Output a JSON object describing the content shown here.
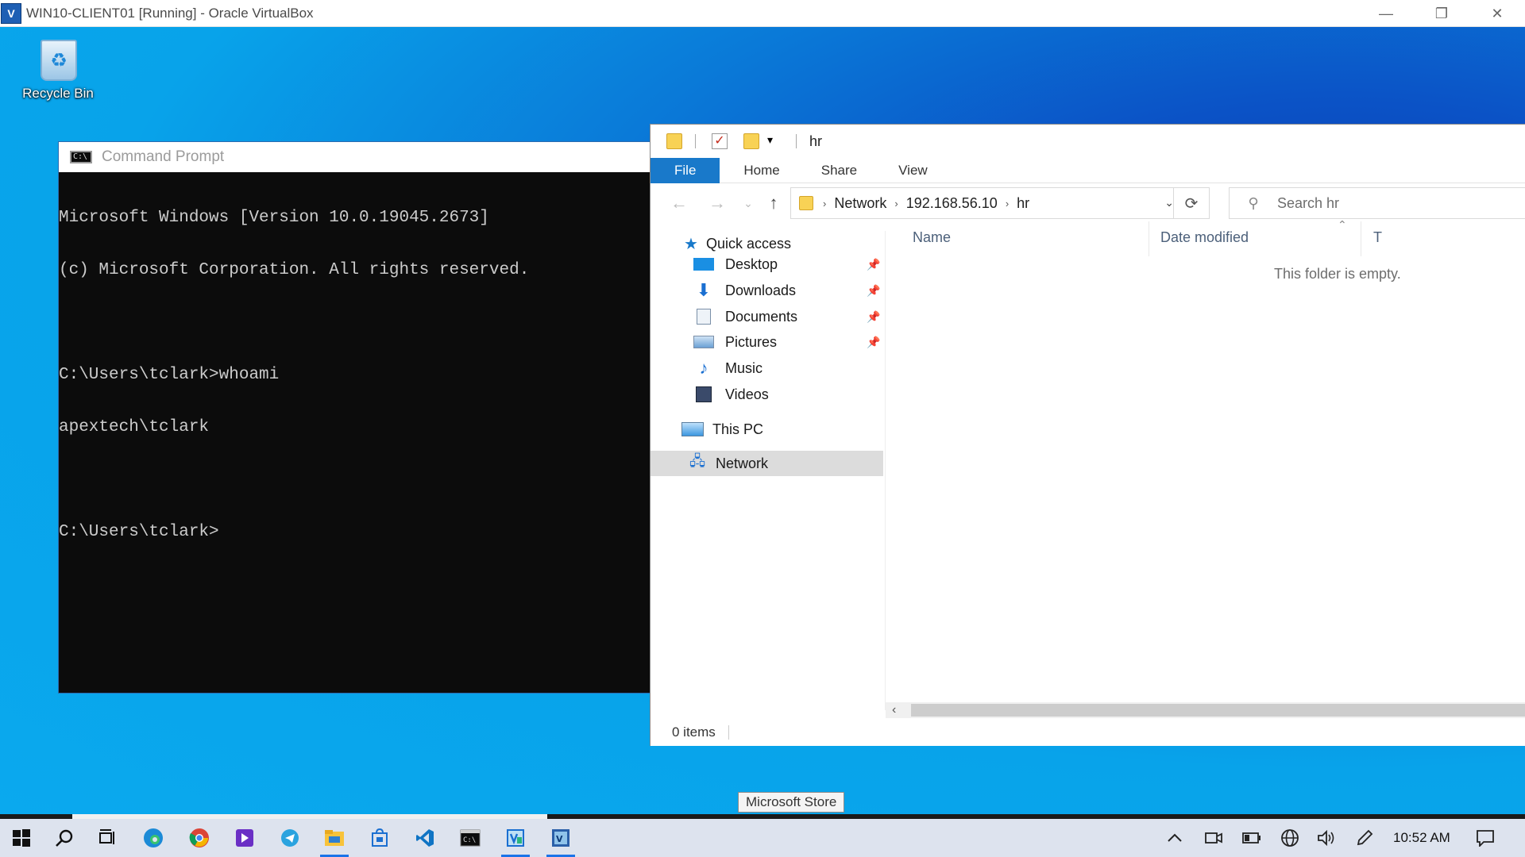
{
  "host": {
    "title": "WIN10-CLIENT01 [Running] - Oracle VirtualBox",
    "controls": {
      "minimize": "—",
      "restore": "❐",
      "close": "✕"
    }
  },
  "desktop": {
    "icons": [
      {
        "label": "Recycle Bin",
        "icon": "recycle-bin-icon"
      }
    ]
  },
  "cmd": {
    "title": "Command Prompt",
    "lines": [
      "Microsoft Windows [Version 10.0.19045.2673]",
      "(c) Microsoft Corporation. All rights reserved.",
      "",
      "C:\\Users\\tclark>whoami",
      "apextech\\tclark",
      "",
      "C:\\Users\\tclark>"
    ]
  },
  "explorer": {
    "title": "hr",
    "ribbon_tabs": [
      "File",
      "Home",
      "Share",
      "View"
    ],
    "address": [
      "Network",
      "192.168.56.10",
      "hr"
    ],
    "search_placeholder": "Search hr",
    "nav": {
      "quick_access": "Quick access",
      "pinned": [
        "Desktop",
        "Downloads",
        "Documents",
        "Pictures"
      ],
      "other": [
        "Music",
        "Videos"
      ],
      "this_pc": "This PC",
      "network": "Network"
    },
    "columns": [
      "Name",
      "Date modified",
      "T"
    ],
    "empty_message": "This folder is empty.",
    "status": "0 items"
  },
  "tooltip": "Microsoft Store",
  "taskbar": {
    "clock": "10:52 AM",
    "apps": [
      "start-icon",
      "search-icon",
      "task-view-icon",
      "edge-icon",
      "chrome-icon",
      "app-icon",
      "telegram-icon",
      "file-explorer-icon",
      "store-icon",
      "vscode-icon",
      "terminal-icon",
      "virtualbox-manager-icon",
      "virtualbox-vm-icon"
    ]
  },
  "colors": {
    "accent": "#1979ca",
    "desktop_light": "#0aa9ee",
    "desktop_dark": "#0a3fae",
    "console_bg": "#0c0c0c",
    "console_fg": "#cccccc"
  }
}
